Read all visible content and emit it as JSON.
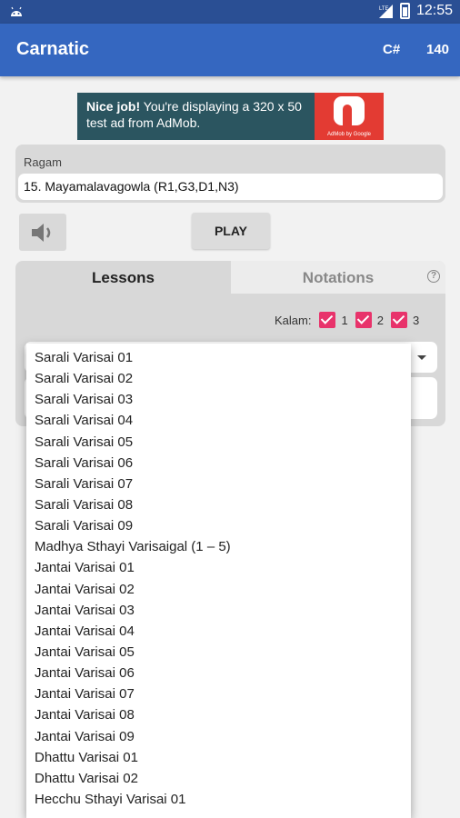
{
  "status_bar": {
    "time": "12:55",
    "icons": [
      "android-icon",
      "signal-icon",
      "battery-icon"
    ]
  },
  "app_bar": {
    "title": "Carnatic",
    "key": "C#",
    "tempo": "140"
  },
  "ad": {
    "headline": "Nice job!",
    "text": " You're displaying a 320 x 50 test ad from AdMob.",
    "logo_caption": "AdMob by Google"
  },
  "ragam": {
    "label": "Ragam",
    "value": "15. Mayamalavagowla (R1,G3,D1,N3)"
  },
  "controls": {
    "speaker_icon": "speaker-icon",
    "play_label": "PLAY"
  },
  "tabs": {
    "lessons": "Lessons",
    "notations": "Notations",
    "help_icon": "?"
  },
  "kalam": {
    "label": "Kalam:",
    "options": [
      {
        "label": "1",
        "checked": true
      },
      {
        "label": "2",
        "checked": true
      },
      {
        "label": "3",
        "checked": true
      }
    ]
  },
  "lessons_dropdown": {
    "items": [
      "Sarali Varisai 01",
      "Sarali Varisai 02",
      "Sarali Varisai 03",
      "Sarali Varisai 04",
      "Sarali Varisai 05",
      "Sarali Varisai 06",
      "Sarali Varisai 07",
      "Sarali Varisai 08",
      "Sarali Varisai 09",
      "Madhya Sthayi Varisaigal (1 – 5)",
      "Jantai Varisai 01",
      "Jantai Varisai 02",
      "Jantai Varisai 03",
      "Jantai Varisai 04",
      "Jantai Varisai 05",
      "Jantai Varisai 06",
      "Jantai Varisai 07",
      "Jantai Varisai 08",
      "Jantai Varisai 09",
      "Dhattu Varisai 01",
      "Dhattu Varisai 02",
      "Hecchu Sthayi Varisai 01"
    ]
  },
  "colors": {
    "status_bar": "#2a4f94",
    "app_bar": "#3567c0",
    "checkbox": "#e8336b",
    "ad_background": "#2b5560",
    "ad_logo": "#e33b33"
  }
}
